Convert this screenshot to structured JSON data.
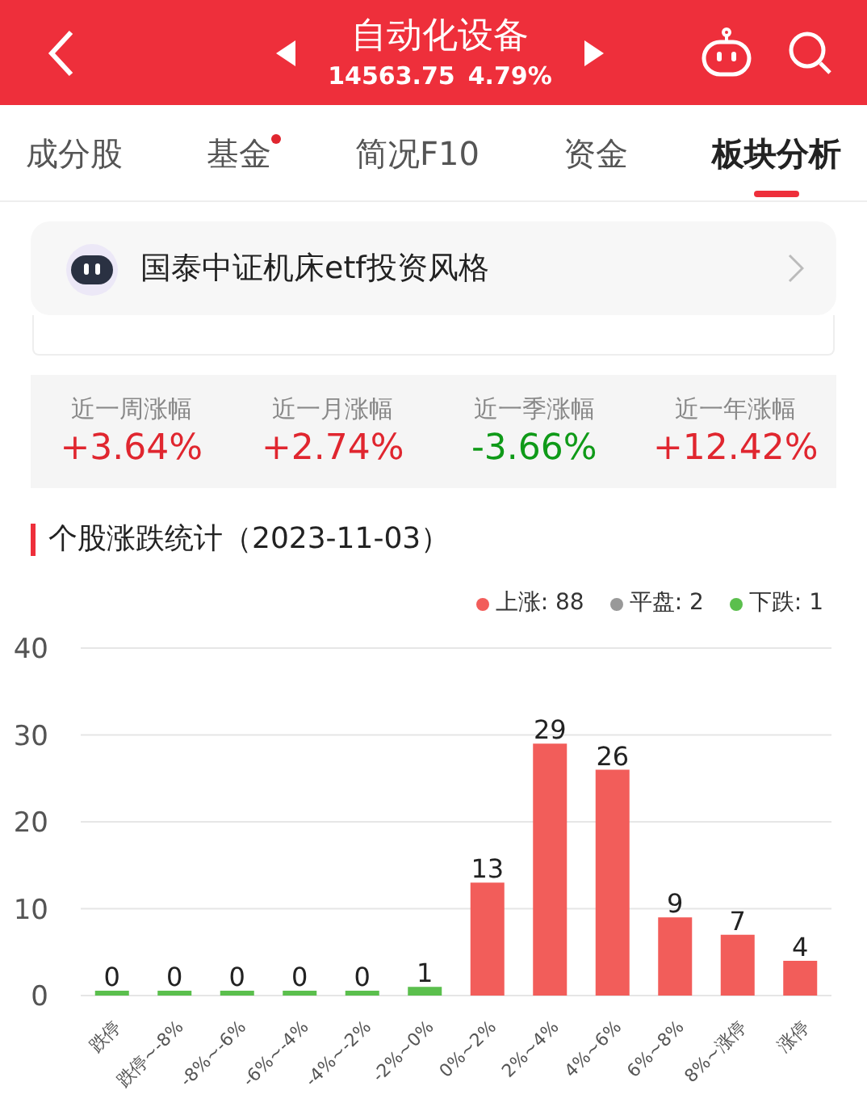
{
  "header": {
    "title": "自动化设备",
    "index_value": "14563.75",
    "change": "4.79%"
  },
  "tabs": [
    {
      "label": "成分股",
      "selected": false,
      "dot": false
    },
    {
      "label": "基金",
      "selected": false,
      "dot": true
    },
    {
      "label": "简况F10",
      "selected": false,
      "dot": false
    },
    {
      "label": "资金",
      "selected": false,
      "dot": false
    },
    {
      "label": "板块分析",
      "selected": true,
      "dot": false
    }
  ],
  "style_card": {
    "text": "国泰中证机床etf投资风格"
  },
  "stats": [
    {
      "label": "近一周涨幅",
      "value": "+3.64%",
      "color": "#e0262f"
    },
    {
      "label": "近一月涨幅",
      "value": "+2.74%",
      "color": "#e0262f"
    },
    {
      "label": "近一季涨幅",
      "value": "-3.66%",
      "color": "#0f9a18"
    },
    {
      "label": "近一年涨幅",
      "value": "+12.42%",
      "color": "#e0262f"
    }
  ],
  "section_title": "个股涨跌统计（2023-11-03）",
  "legend": [
    {
      "label": "上涨: 88",
      "color": "#f25d5a"
    },
    {
      "label": "平盘: 2",
      "color": "#999999"
    },
    {
      "label": "下跌: 1",
      "color": "#5bbf4d"
    }
  ],
  "chart_data": {
    "type": "bar",
    "categories": [
      "跌停",
      "跌停~-8%",
      "-8%~-6%",
      "-6%~-4%",
      "-4%~-2%",
      "-2%~0%",
      "0%~2%",
      "2%~4%",
      "4%~6%",
      "6%~8%",
      "8%~涨停",
      "涨停"
    ],
    "series": [
      {
        "color": "#5bbf4d",
        "values": [
          0,
          0,
          0,
          0,
          0,
          1,
          null,
          null,
          null,
          null,
          null,
          null
        ]
      },
      {
        "color": "#f25d5a",
        "values": [
          null,
          null,
          null,
          null,
          null,
          null,
          13,
          29,
          26,
          9,
          7,
          4
        ]
      }
    ],
    "ylim": [
      0,
      40
    ],
    "yticks": [
      0,
      10,
      20,
      30,
      40
    ],
    "grid": true,
    "data_labels": true
  }
}
